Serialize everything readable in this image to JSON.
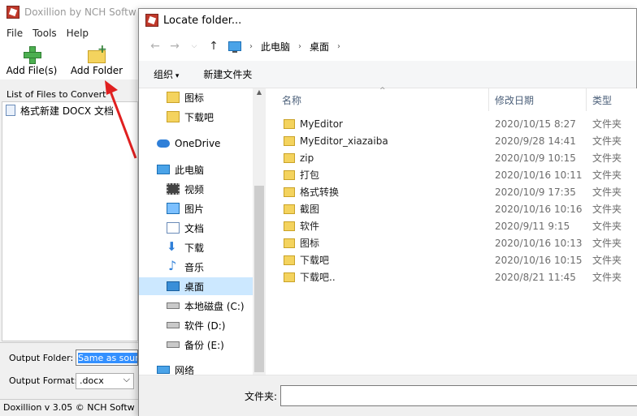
{
  "app": {
    "title": "Doxillion by NCH Softw",
    "menu": [
      "File",
      "Tools",
      "Help"
    ],
    "toolbar": {
      "add_files": "Add File(s)",
      "add_folder": "Add Folder"
    },
    "list_label": "List of Files to Convert",
    "files": [
      "格式新建 DOCX 文档"
    ],
    "output_folder_label": "Output Folder:",
    "output_folder_value": "Same as sourc",
    "output_format_label": "Output Format:",
    "output_format_value": ".docx",
    "status": "Doxillion v 3.05 © NCH Softw"
  },
  "dialog": {
    "title": "Locate folder...",
    "breadcrumb": [
      "此电脑",
      "桌面"
    ],
    "organize": "组织",
    "new_folder": "新建文件夹",
    "nav": [
      {
        "label": "图标",
        "icon": "folder-icon"
      },
      {
        "label": "下载吧",
        "icon": "folder-icon"
      },
      {
        "label": "OneDrive",
        "icon": "cloud-icon"
      },
      {
        "label": "此电脑",
        "icon": "computer-icon"
      },
      {
        "label": "视频",
        "icon": "video-icon"
      },
      {
        "label": "图片",
        "icon": "picture-icon"
      },
      {
        "label": "文档",
        "icon": "document-icon"
      },
      {
        "label": "下载",
        "icon": "download-icon"
      },
      {
        "label": "音乐",
        "icon": "music-icon"
      },
      {
        "label": "桌面",
        "icon": "desktop-icon"
      },
      {
        "label": "本地磁盘 (C:)",
        "icon": "drive-icon"
      },
      {
        "label": "软件 (D:)",
        "icon": "drive-icon"
      },
      {
        "label": "备份 (E:)",
        "icon": "drive-icon"
      },
      {
        "label": "网络",
        "icon": "network-icon"
      }
    ],
    "columns": {
      "name": "名称",
      "date": "修改日期",
      "type": "类型"
    },
    "rows": [
      {
        "name": "MyEditor",
        "date": "2020/10/15 8:27",
        "type": "文件夹"
      },
      {
        "name": "MyEditor_xiazaiba",
        "date": "2020/9/28 14:41",
        "type": "文件夹"
      },
      {
        "name": "zip",
        "date": "2020/10/9 10:15",
        "type": "文件夹"
      },
      {
        "name": "打包",
        "date": "2020/10/16 10:11",
        "type": "文件夹"
      },
      {
        "name": "格式转换",
        "date": "2020/10/9 17:35",
        "type": "文件夹"
      },
      {
        "name": "截图",
        "date": "2020/10/16 10:16",
        "type": "文件夹"
      },
      {
        "name": "软件",
        "date": "2020/9/11 9:15",
        "type": "文件夹"
      },
      {
        "name": "图标",
        "date": "2020/10/16 10:13",
        "type": "文件夹"
      },
      {
        "name": "下载吧",
        "date": "2020/10/16 10:15",
        "type": "文件夹"
      },
      {
        "name": "下载吧..",
        "date": "2020/8/21 11:45",
        "type": "文件夹"
      }
    ],
    "folder_label": "文件夹:",
    "folder_value": ""
  },
  "colors": {
    "selection": "#cce8ff",
    "accent": "#0078d7",
    "arrow": "#e02020"
  }
}
